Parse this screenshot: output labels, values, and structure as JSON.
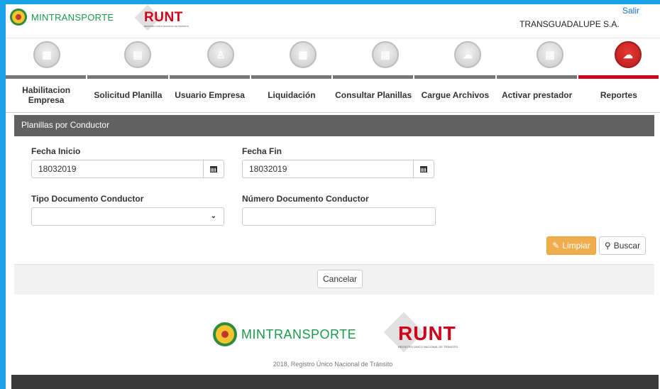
{
  "header": {
    "mint_logo_text": "MINTRANSPORTE",
    "runt_logo_text": "RUNT",
    "runt_logo_sub": "REGISTRO ÚNICO NACIONAL DE TRÁNSITO",
    "company": "TRANSGUADALUPE S.A.",
    "logout": "Salir"
  },
  "nav": {
    "icons": [
      {
        "name": "building-icon",
        "glyph": "▦"
      },
      {
        "name": "document-icon",
        "glyph": "▤"
      },
      {
        "name": "user-icon",
        "glyph": "♙"
      },
      {
        "name": "calculator-icon",
        "glyph": "▦"
      },
      {
        "name": "document-search-icon",
        "glyph": "▤"
      },
      {
        "name": "cloud-upload-icon",
        "glyph": "☁"
      },
      {
        "name": "document-check-icon",
        "glyph": "▤"
      },
      {
        "name": "report-cloud-icon",
        "glyph": "☁"
      }
    ],
    "tabs": [
      "Habilitacion Empresa",
      "Solicitud Planilla",
      "Usuario Empresa",
      "Liquidación",
      "Consultar Planillas",
      "Cargue Archivos",
      "Activar prestador",
      "Reportes"
    ],
    "active_tab": 7,
    "active_color": "#d0021b"
  },
  "panel": {
    "title": "Planillas por Conductor",
    "fecha_inicio_label": "Fecha Inicio",
    "fecha_inicio_value": "18032019",
    "fecha_fin_label": "Fecha Fin",
    "fecha_fin_value": "18032019",
    "tipo_doc_label": "Tipo Documento Conductor",
    "tipo_doc_value": "",
    "num_doc_label": "Número Documento Conductor",
    "num_doc_value": "",
    "limpiar_label": "Limpiar",
    "buscar_label": "Buscar",
    "cancelar_label": "Cancelar"
  },
  "footer": {
    "mint_text": "MINTRANSPORTE",
    "runt_text": "RUNT",
    "runt_sub": "REGISTRO ÚNICO NACIONAL DE TRÁNSITO",
    "copyright": "2018, Registro Único Nacional de Tránsito"
  }
}
